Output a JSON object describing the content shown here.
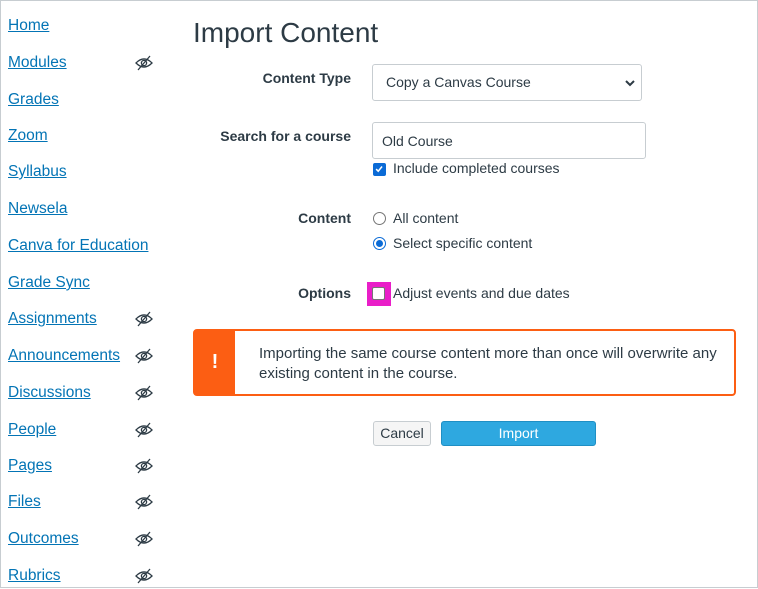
{
  "sidebar": {
    "items": [
      {
        "label": "Home",
        "hidden": false
      },
      {
        "label": "Modules",
        "hidden": true
      },
      {
        "label": "Grades",
        "hidden": false
      },
      {
        "label": "Zoom",
        "hidden": false
      },
      {
        "label": "Syllabus",
        "hidden": false
      },
      {
        "label": "Newsela",
        "hidden": false
      },
      {
        "label": "Canva for Education",
        "hidden": false
      },
      {
        "label": "Grade Sync",
        "hidden": false
      },
      {
        "label": "Assignments",
        "hidden": true
      },
      {
        "label": "Announcements",
        "hidden": true
      },
      {
        "label": "Discussions",
        "hidden": true
      },
      {
        "label": "People",
        "hidden": true
      },
      {
        "label": "Pages",
        "hidden": true
      },
      {
        "label": "Files",
        "hidden": true
      },
      {
        "label": "Outcomes",
        "hidden": true
      },
      {
        "label": "Rubrics",
        "hidden": true
      }
    ]
  },
  "main": {
    "title": "Import Content",
    "content_type": {
      "label": "Content Type",
      "selected": "Copy a Canvas Course"
    },
    "search": {
      "label": "Search for a course",
      "value": "Old Course",
      "include_completed_label": "Include completed courses",
      "include_completed_checked": true
    },
    "content": {
      "label": "Content",
      "options": [
        "All content",
        "Select specific content"
      ],
      "selected_index": 1
    },
    "options": {
      "label": "Options",
      "adjust_dates_label": "Adjust events and due dates",
      "adjust_dates_checked": false
    },
    "alert": {
      "icon": "!",
      "text": "Importing the same course content more than once will overwrite any existing content in the course."
    },
    "buttons": {
      "cancel": "Cancel",
      "import": "Import"
    }
  },
  "colors": {
    "link": "#0374b5",
    "accent": "#0b6bd6",
    "alert": "#fc5e13",
    "primary_button": "#2ea8e0",
    "highlight": "#e91ec8"
  }
}
